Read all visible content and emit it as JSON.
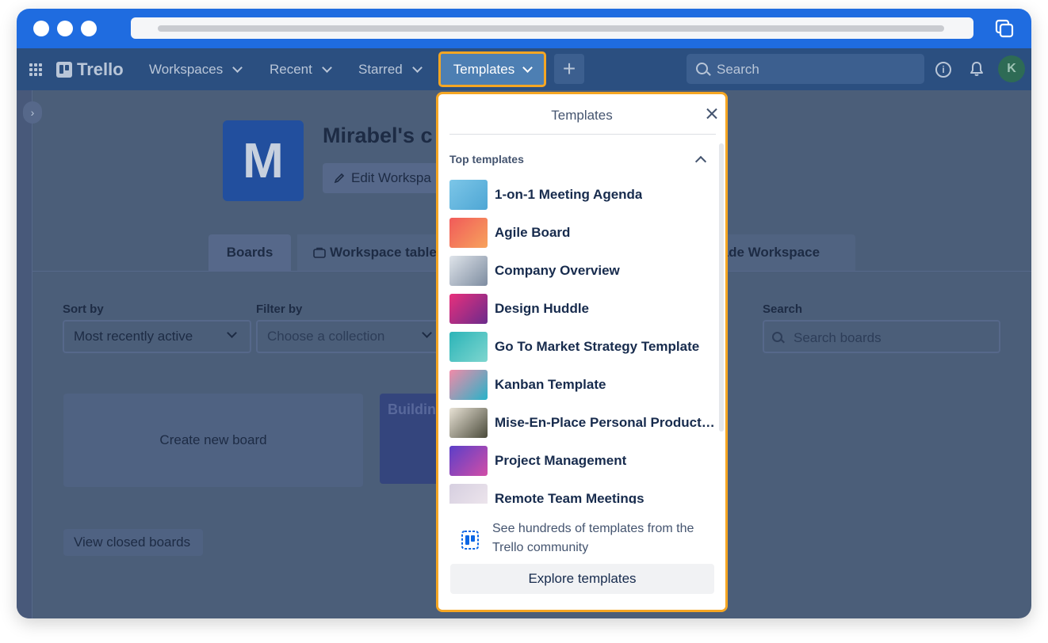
{
  "topbar": {
    "logo_text": "Trello",
    "nav": [
      "Workspaces",
      "Recent",
      "Starred"
    ],
    "templates_label": "Templates",
    "plus_label": "+",
    "search_placeholder": "Search",
    "avatar_initial": "K"
  },
  "workspace": {
    "logo_letter": "M",
    "name": "Mirabel's c",
    "edit_label": "Edit Workspa",
    "tabs": {
      "boards": "Boards",
      "table": "Workspace table",
      "upgrade": "rade Workspace"
    },
    "sort_label": "Sort by",
    "sort_value": "Most recently active",
    "filter_label": "Filter by",
    "filter_placeholder": "Choose a collection",
    "search_label": "Search",
    "search_placeholder": "Search boards",
    "create_board": "Create new board",
    "board_tile": "Buildin",
    "closed_boards": "View closed boards"
  },
  "templates_popup": {
    "title": "Templates",
    "section": "Top templates",
    "items": [
      {
        "name": "1-on-1 Meeting Agenda",
        "colors": [
          "#7cc6e8",
          "#4ea6d4"
        ]
      },
      {
        "name": "Agile Board",
        "colors": [
          "#f15a5a",
          "#f7a35c"
        ]
      },
      {
        "name": "Company Overview",
        "colors": [
          "#dfe4ea",
          "#7d8ca0"
        ]
      },
      {
        "name": "Design Huddle",
        "colors": [
          "#e8307c",
          "#6b2b8c"
        ]
      },
      {
        "name": "Go To Market Strategy Template",
        "colors": [
          "#2bb4b8",
          "#7ed6cf"
        ]
      },
      {
        "name": "Kanban Template",
        "colors": [
          "#f28aa8",
          "#27b3c9"
        ]
      },
      {
        "name": "Mise-En-Place Personal Productivity System",
        "colors": [
          "#e9e3d6",
          "#4a4a3a"
        ]
      },
      {
        "name": "Project Management",
        "colors": [
          "#5b3fc8",
          "#d24ea7"
        ]
      },
      {
        "name": "Remote Team Meetings",
        "colors": [
          "#d6cfe0",
          "#f0e8ee"
        ]
      }
    ],
    "footer_text": "See hundreds of templates from the Trello community",
    "explore_label": "Explore templates"
  },
  "colors": {
    "browser_chrome": "#1f6ce0",
    "nav_bg": "#2b4f80",
    "highlight": "#f5a623",
    "overlay": "#4b5e79"
  }
}
